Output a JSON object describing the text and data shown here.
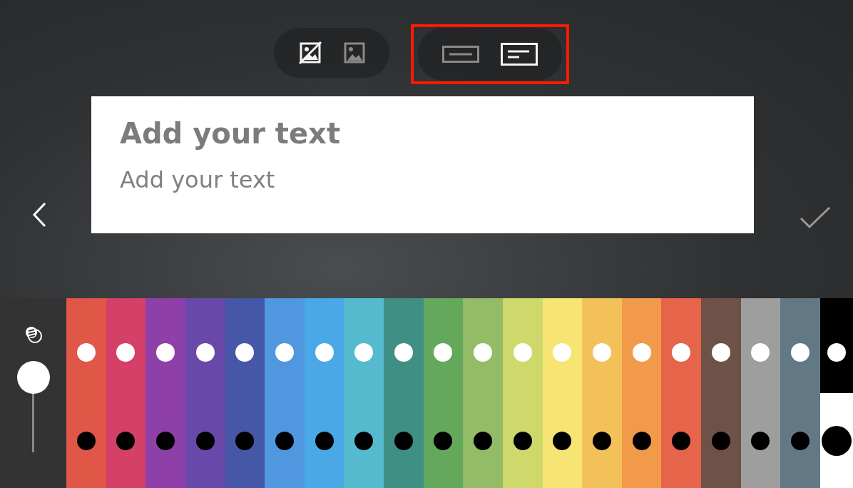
{
  "toolbar": {
    "image_toggle": [
      {
        "kind": "no-image",
        "selected": true
      },
      {
        "kind": "image",
        "selected": false
      }
    ],
    "layout_toggle": {
      "highlighted": true,
      "options": [
        {
          "kind": "banner",
          "selected": false
        },
        {
          "kind": "left-aligned",
          "selected": true
        }
      ]
    }
  },
  "card": {
    "title": "Add your text",
    "subtitle": "Add your text"
  },
  "opacity_slider": {
    "level": 1
  },
  "swatches": [
    {
      "kind": "plain",
      "color": "#e05647",
      "selected": false
    },
    {
      "kind": "plain",
      "color": "#d44068",
      "selected": false
    },
    {
      "kind": "plain",
      "color": "#8e3fa8",
      "selected": false
    },
    {
      "kind": "plain",
      "color": "#6848a8",
      "selected": false
    },
    {
      "kind": "plain",
      "color": "#4557a6",
      "selected": false
    },
    {
      "kind": "plain",
      "color": "#4f98e0",
      "selected": false
    },
    {
      "kind": "plain",
      "color": "#4aa8e6",
      "selected": false
    },
    {
      "kind": "plain",
      "color": "#56bacf",
      "selected": false
    },
    {
      "kind": "plain",
      "color": "#3f8f84",
      "selected": false
    },
    {
      "kind": "plain",
      "color": "#64a85c",
      "selected": false
    },
    {
      "kind": "plain",
      "color": "#94bb66",
      "selected": false
    },
    {
      "kind": "plain",
      "color": "#cfd86a",
      "selected": false
    },
    {
      "kind": "plain",
      "color": "#f6e572",
      "selected": false
    },
    {
      "kind": "plain",
      "color": "#f2c15a",
      "selected": false
    },
    {
      "kind": "plain",
      "color": "#f19a4a",
      "selected": false
    },
    {
      "kind": "plain",
      "color": "#e5644a",
      "selected": false
    },
    {
      "kind": "plain",
      "color": "#6e5147",
      "selected": false
    },
    {
      "kind": "plain",
      "color": "#9e9e9e",
      "selected": false
    },
    {
      "kind": "plain",
      "color": "#627985",
      "selected": false
    },
    {
      "kind": "split",
      "color": "#000000",
      "selected": true
    }
  ]
}
